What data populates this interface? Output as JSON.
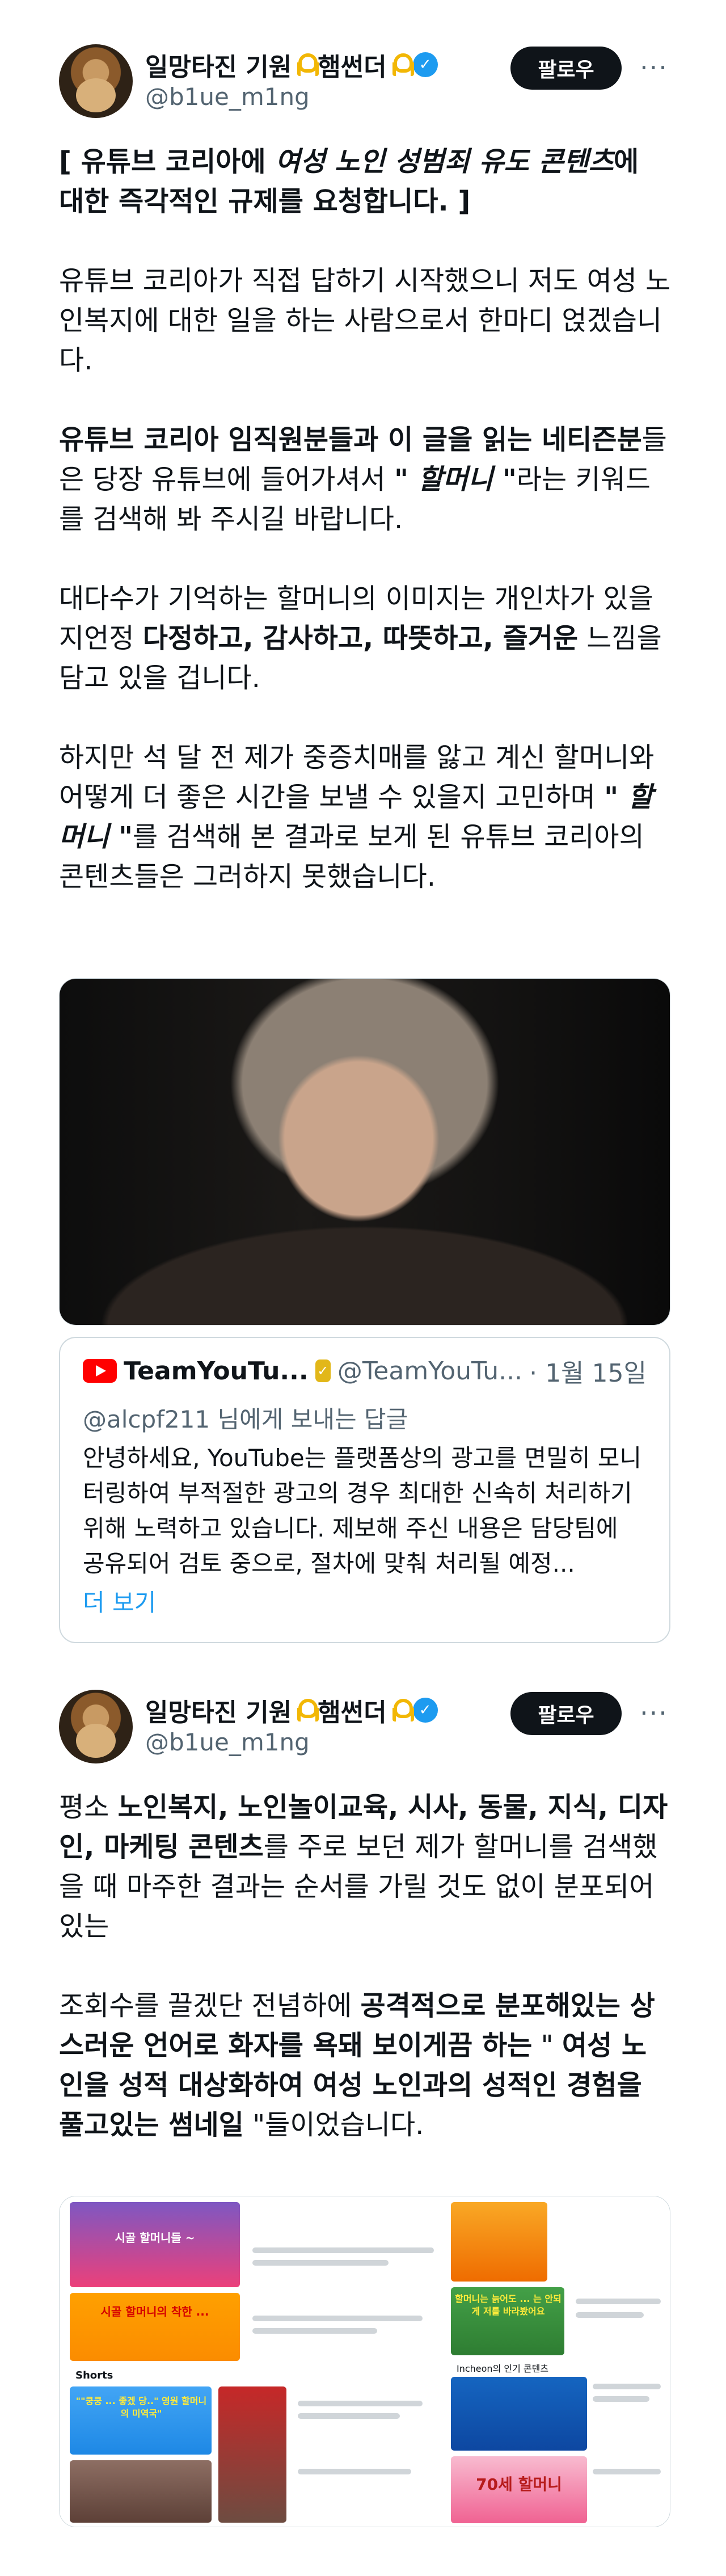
{
  "post1": {
    "display_name": "일망타진 기원",
    "display_name2": "햄썬더",
    "handle": "@b1ue_m1ng",
    "follow_label": "팔로우",
    "more_label": "···",
    "title_line": "[ 유튜브 코리아에 ",
    "title_em": "여성 노인 성범죄 유도 콘텐츠",
    "title_rest": "에 대한 즉각적인 규제를 요청합니다. ]",
    "p1": "유튜브 코리아가 직접 답하기 시작했으니 저도 여성 노인복지에 대한 일을 하는 사람으로서 한마디 얹겠습니다.",
    "p2_bold": "유튜브 코리아 임직원분들과 이 글을 읽는 네티즌분",
    "p2_rest1": "들은 당장 유튜브에 들어가셔서 ",
    "p2_em": "\" 할머니 \"",
    "p2_rest2": "라는 키워드를 검색해 봐 주시길 바랍니다.",
    "p3a": "대다수가 기억하는 할머니의 이미지는 개인차가 있을지언정 ",
    "p3_bold": "다정하고, 감사하고, 따뜻하고, 즐거운",
    "p3b": " 느낌을 담고 있을 겁니다.",
    "p4a": "하지만 석 달 전 제가 중증치매를 앓고 계신 할머니와 어떻게 더 좋은 시간을 보낼 수 있을지 고민하며 ",
    "p4_em": "\" 할머니 \"",
    "p4b": "를 검색해 본 결과로 보게 된 유튜브 코리아의 콘텐츠들은 그러하지 못했습니다."
  },
  "quote": {
    "name": "TeamYouTu...",
    "handle": "@TeamYouTu...",
    "date": "· 1월 15일",
    "reply_to": "@alcpf211 님에게 보내는 답글",
    "text": "안녕하세요, YouTube는 플랫폼상의 광고를 면밀히 모니터링하여 부적절한 광고의 경우 최대한 신속히 처리하기 위해 노력하고 있습니다. 제보해 주신 내용은 담당팀에 공유되어 검토 중으로, 절차에 맞춰 처리될 예정...",
    "more": "더 보기"
  },
  "post2": {
    "display_name": "일망타진 기원",
    "display_name2": "햄썬더",
    "handle": "@b1ue_m1ng",
    "follow_label": "팔로우",
    "more_label": "···",
    "p1a": "평소 ",
    "p1_bold": "노인복지, 노인놀이교육, 시사, 동물, 지식, 디자인, 마케팅 콘텐츠",
    "p1b": "를 주로 보던 제가 할머니를 검색했을 때 마주한 결과는 순서를 가릴 것도 없이 분포되어 있는",
    "p2a": "조회수를 끌겠단 전념하에 ",
    "p2_bold1": "공격적으로 분포해있는 상스러운 언어로 화자를 욕돼 보이게끔 하는",
    "p2b": " \" ",
    "p2_bold2": "여성 노인을 성적 대상화하여 여성 노인과의 성적인 경험을 풀고있는 썸네일",
    "p2c": " \"들이었습니다."
  },
  "thumbs": {
    "t1": "시골 할머니들 ~",
    "t2": "시골 할머니의 착한 ...",
    "t3": "할머니는 늙어도 ... 는 안되게 저를 바라봤어요",
    "t4": "\"\"쿵쿵 ... 좋겠 당..\" 영원 할머니의 미역국\"",
    "t5": "70세 할머니",
    "shorts": "Shorts",
    "section": "Incheon의 인기 콘텐츠"
  },
  "colors": {
    "accent": "#1d9bf0",
    "text": "#0f1419",
    "muted": "#536471",
    "ribbon": "#f2b705"
  }
}
